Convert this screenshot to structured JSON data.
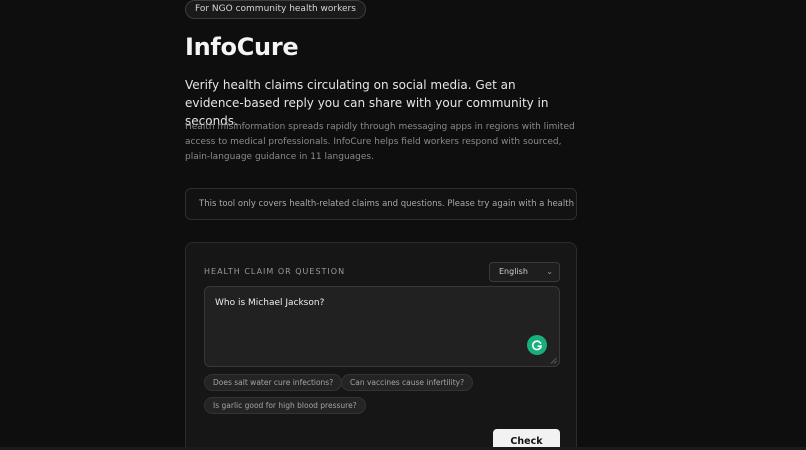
{
  "badge": "For NGO community health workers",
  "app_title": "InfoCure",
  "lead": "Verify health claims circulating on social media. Get an evidence-based reply you can share with your community in seconds.",
  "description": "Health misinformation spreads rapidly through messaging apps in regions with limited access to medical professionals. InfoCure helps field workers respond with sourced, plain-language guidance in 11 languages.",
  "notice": "This tool only covers health-related claims and questions. Please try again with a health topic.",
  "form": {
    "label": "HEALTH CLAIM OR QUESTION",
    "language": {
      "selected": "English",
      "chevron": "⌄"
    },
    "query": "Who is Michael Jackson?",
    "suggestions": [
      "Does salt water cure infections?",
      "Can vaccines cause infertility?",
      "Is garlic good for high blood pressure?"
    ],
    "submit_label": "Check"
  },
  "colors": {
    "background": "#0e0e0e",
    "card": "#161616",
    "grammarly": "#17b07c",
    "button": "#f2f2f2"
  },
  "icons": {
    "assistant": "grammarly-icon",
    "resize": "resize-handle-icon",
    "dropdown": "chevron-down-icon"
  }
}
